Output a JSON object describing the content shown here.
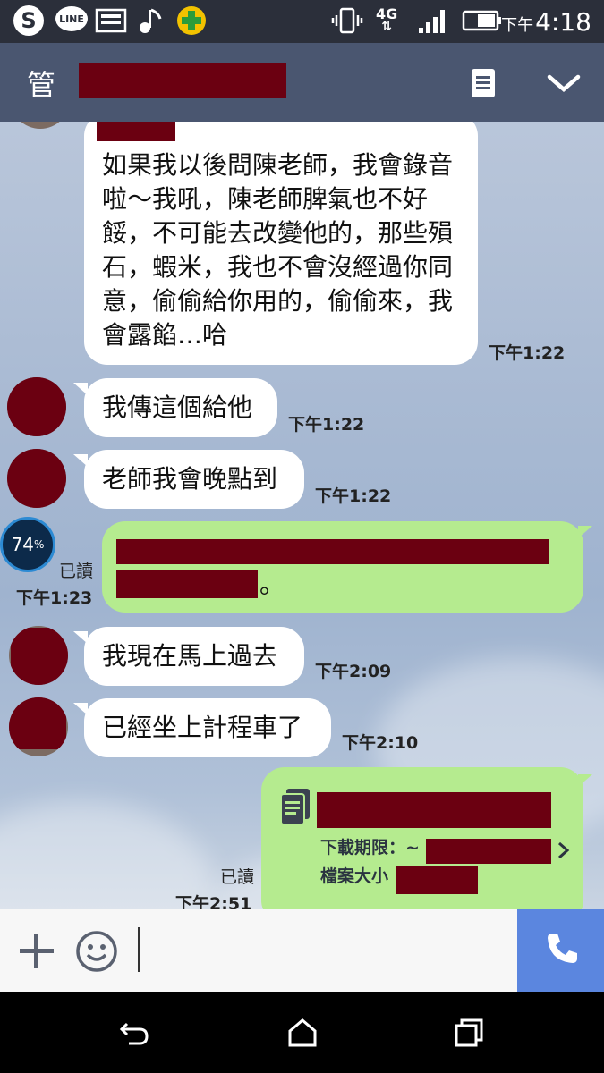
{
  "status_bar": {
    "network": "4G",
    "time_prefix": "下午",
    "time": "4:18",
    "line_icon_label": "LINE"
  },
  "header": {
    "title_visible": "管"
  },
  "messages": {
    "m1": {
      "text": "如果我以後問陳老師，我會錄音啦～我吼，陳老師脾氣也不好餒，不可能去改變他的，那些殞石，蝦米，我也不會沒經過你同意，偷偷給你用的，偷偷來，我會露餡…哈",
      "time": "下午1:22"
    },
    "m2": {
      "text": "我傳這個給他",
      "time": "下午1:22"
    },
    "m3": {
      "text": "老師我會晚點到",
      "time": "下午1:22"
    },
    "m4": {
      "text_tail": "。",
      "read": "已讀",
      "time": "下午1:23",
      "battery_badge": "74",
      "battery_pct": "%"
    },
    "m5": {
      "text": "我現在馬上過去",
      "time": "下午2:09"
    },
    "m6": {
      "text": "已經坐上計程車了",
      "time": "下午2:10"
    },
    "m7": {
      "expire_label": "下載期限：~",
      "size_label": "檔案大小",
      "read": "已讀",
      "time": "下午2:51"
    }
  },
  "colors": {
    "header_bg": "#4a5670",
    "statusbar_bg": "#2b2f3a",
    "out_bubble": "#b5eb8f",
    "in_bubble": "#ffffff",
    "call_button": "#5b86df",
    "redaction": "#6b0011"
  },
  "icons": [
    "skype-icon",
    "line-icon",
    "image-icon",
    "music-icon",
    "plus-app-icon",
    "vibrate-icon",
    "signal-icon",
    "battery-icon",
    "menu-icon",
    "chevron-down-icon",
    "file-icon",
    "chevron-right-icon",
    "plus-icon",
    "emoji-icon",
    "phone-icon",
    "back-icon",
    "home-icon",
    "recents-icon"
  ]
}
